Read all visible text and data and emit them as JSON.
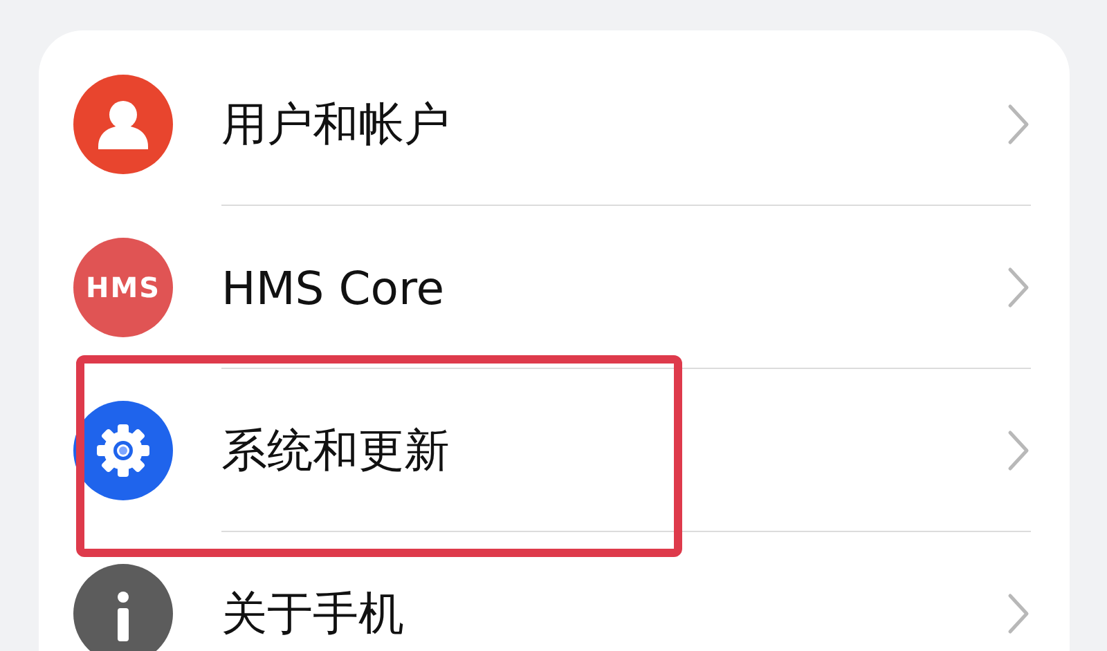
{
  "settings_items": [
    {
      "kind": "user",
      "label": "用户和帐户",
      "highlighted": false
    },
    {
      "kind": "hms",
      "label": "HMS Core",
      "icon_text": "HMS",
      "highlighted": false
    },
    {
      "kind": "gear",
      "label": "系统和更新",
      "highlighted": true
    },
    {
      "kind": "info",
      "label": "关于手机",
      "highlighted": false
    }
  ]
}
